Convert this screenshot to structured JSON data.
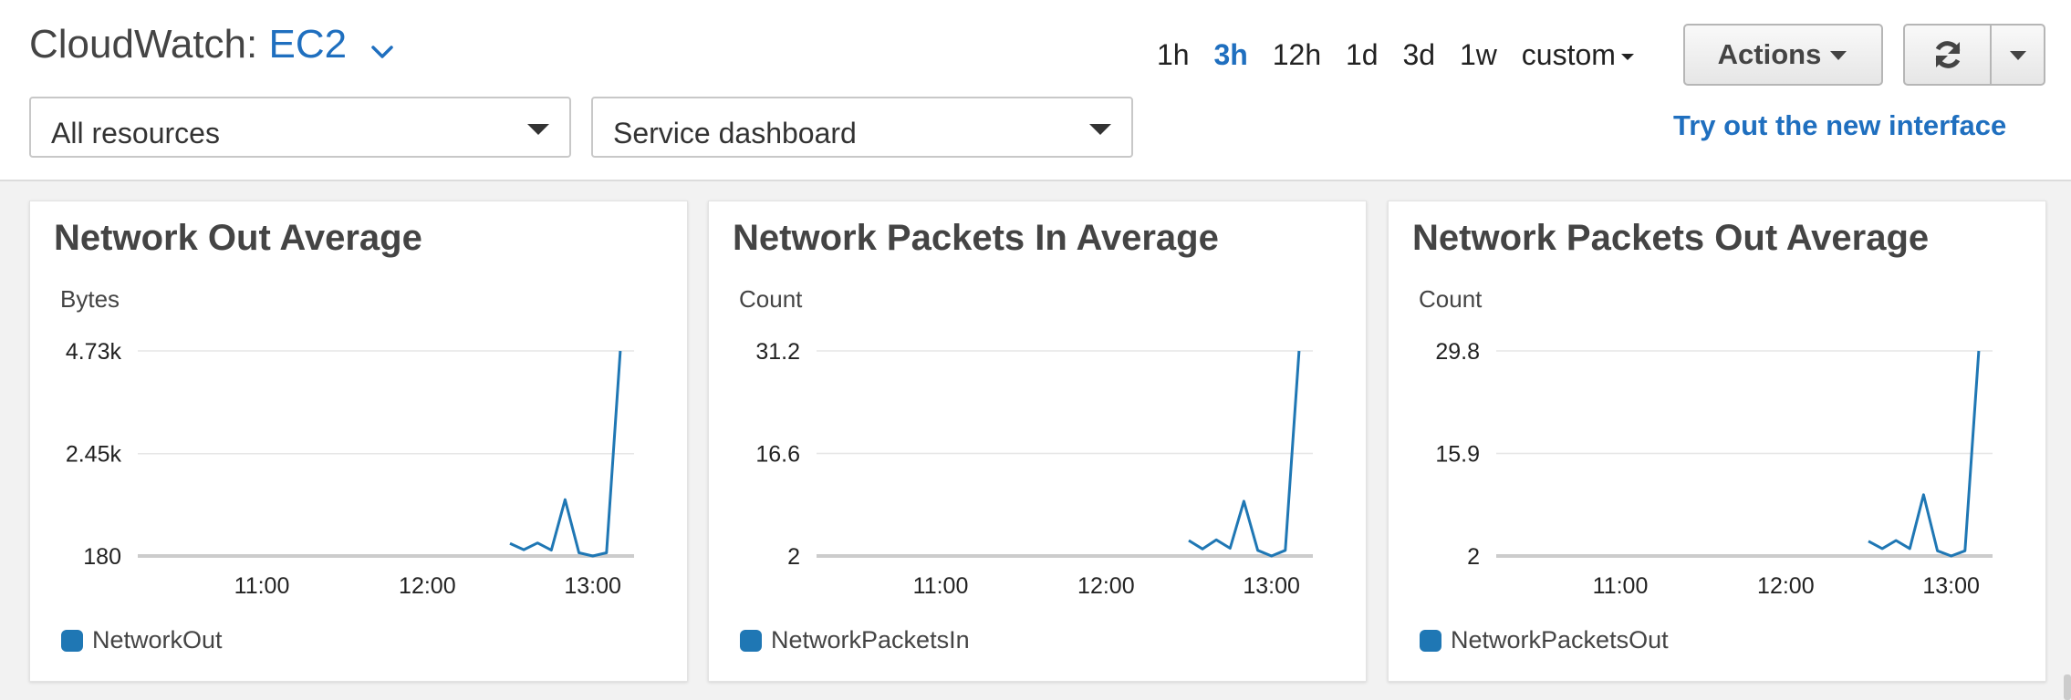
{
  "header": {
    "title_prefix": "CloudWatch:",
    "service": "EC2",
    "resources_dropdown": "All resources",
    "dashboard_dropdown": "Service dashboard",
    "time_ranges": [
      "1h",
      "3h",
      "12h",
      "1d",
      "3d",
      "1w"
    ],
    "active_time_range": "3h",
    "custom_label": "custom",
    "actions_label": "Actions",
    "new_interface_link": "Try out the new interface",
    "accent_color": "#1f6fbf"
  },
  "widgets": [
    {
      "title": "Network Out Average",
      "unit": "Bytes",
      "legend": "NetworkOut",
      "ticks_y": [
        "4.73k",
        "2.45k",
        "180"
      ],
      "ticks_x": [
        "11:00",
        "12:00",
        "13:00"
      ]
    },
    {
      "title": "Network Packets In Average",
      "unit": "Count",
      "legend": "NetworkPacketsIn",
      "ticks_y": [
        "31.2",
        "16.6",
        "2"
      ],
      "ticks_x": [
        "11:00",
        "12:00",
        "13:00"
      ]
    },
    {
      "title": "Network Packets Out Average",
      "unit": "Count",
      "legend": "NetworkPacketsOut",
      "ticks_y": [
        "29.8",
        "15.9",
        "2"
      ],
      "ticks_x": [
        "11:00",
        "12:00",
        "13:00"
      ]
    }
  ],
  "chart_data": [
    {
      "type": "line",
      "title": "Network Out Average",
      "ylabel": "Bytes",
      "x": [
        "12:30",
        "12:35",
        "12:40",
        "12:45",
        "12:50",
        "12:55",
        "13:00",
        "13:05",
        "13:10"
      ],
      "x_time_minutes": [
        750,
        755,
        760,
        765,
        770,
        775,
        780,
        785,
        790
      ],
      "series": [
        {
          "name": "NetworkOut",
          "values": [
            460,
            320,
            470,
            310,
            1430,
            250,
            180,
            250,
            4730
          ]
        }
      ],
      "ylim": [
        180,
        4730
      ],
      "xlim_minutes": [
        615,
        795
      ],
      "y_ticks": [
        180,
        2450,
        4730
      ],
      "x_ticks_minutes": [
        660,
        720,
        780
      ],
      "color": "#1f77b4",
      "grid": true,
      "legend": "bottom-left"
    },
    {
      "type": "line",
      "title": "Network Packets In Average",
      "ylabel": "Count",
      "x": [
        "12:30",
        "12:35",
        "12:40",
        "12:45",
        "12:50",
        "12:55",
        "13:00",
        "13:05",
        "13:10"
      ],
      "x_time_minutes": [
        750,
        755,
        760,
        765,
        770,
        775,
        780,
        785,
        790
      ],
      "series": [
        {
          "name": "NetworkPacketsIn",
          "values": [
            4.2,
            3.0,
            4.3,
            3.1,
            9.8,
            2.8,
            2.0,
            2.8,
            31.2
          ]
        }
      ],
      "ylim": [
        2,
        31.2
      ],
      "xlim_minutes": [
        615,
        795
      ],
      "y_ticks": [
        2,
        16.6,
        31.2
      ],
      "x_ticks_minutes": [
        660,
        720,
        780
      ],
      "color": "#1f77b4",
      "grid": true,
      "legend": "bottom-left"
    },
    {
      "type": "line",
      "title": "Network Packets Out Average",
      "ylabel": "Count",
      "x": [
        "12:30",
        "12:35",
        "12:40",
        "12:45",
        "12:50",
        "12:55",
        "13:00",
        "13:05",
        "13:10"
      ],
      "x_time_minutes": [
        750,
        755,
        760,
        765,
        770,
        775,
        780,
        785,
        790
      ],
      "series": [
        {
          "name": "NetworkPacketsOut",
          "values": [
            4.0,
            3.0,
            4.1,
            3.0,
            10.3,
            2.7,
            2.0,
            2.7,
            29.8
          ]
        }
      ],
      "ylim": [
        2,
        29.8
      ],
      "xlim_minutes": [
        615,
        795
      ],
      "y_ticks": [
        2,
        15.9,
        29.8
      ],
      "x_ticks_minutes": [
        660,
        720,
        780
      ],
      "color": "#1f77b4",
      "grid": true,
      "legend": "bottom-left"
    }
  ]
}
